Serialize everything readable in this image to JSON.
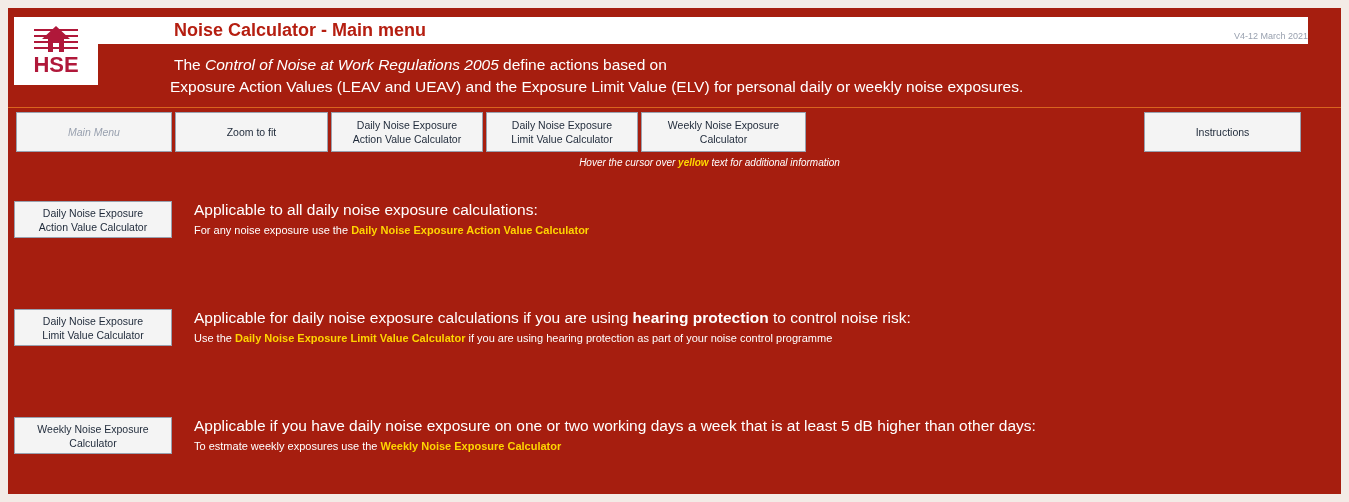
{
  "logo": {
    "text": "HSE"
  },
  "title": "Noise Calculator - Main menu",
  "version": "V4-12 March 2021",
  "intro": [
    "The  *Control of Noise at Work Regulations 2005*  define actions based on",
    "Exposure Action Values (LEAV and UEAV) and the Exposure Limit Value (ELV) for personal daily or weekly noise exposures."
  ],
  "menu": [
    {
      "label": "Main Menu",
      "selected": true
    },
    {
      "label": "Zoom to fit",
      "selected": false
    },
    {
      "label": "Daily Noise Exposure\nAction Value Calculator",
      "selected": false
    },
    {
      "label": "Daily Noise Exposure\nLimit Value Calculator",
      "selected": false
    },
    {
      "label": "Weekly Noise Exposure\nCalculator",
      "selected": false
    },
    {
      "label": "Instructions",
      "selected": false
    }
  ],
  "hint": {
    "before": "Hover the cursor over",
    "highlight": "yellow",
    "after": "text for additional information"
  },
  "sections": [
    {
      "button": "Daily Noise Exposure\nAction Value Calculator",
      "heading": "Applicable to all daily noise exposure calculations:",
      "description": [
        {
          "kind": "plain",
          "text": "For any noise exposure use the "
        },
        {
          "kind": "link",
          "text": "Daily Noise Exposure Action Value Calculator"
        }
      ]
    },
    {
      "button": "Daily Noise Exposure\nLimit Value Calculator",
      "heading": "Applicable for daily noise exposure calculations if you are using **hearing protection** to control noise risk:",
      "description": [
        {
          "kind": "plain",
          "text": "Use the "
        },
        {
          "kind": "link",
          "text": "Daily Noise Exposure Limit Value Calculator"
        },
        {
          "kind": "plain",
          "text": " if you are using hearing protection as part of your noise control programme"
        }
      ]
    },
    {
      "button": "Weekly Noise Exposure\nCalculator",
      "heading": "Applicable if you have daily noise exposure on one or two working days a week that is at least 5 dB higher than other days:",
      "description": [
        {
          "kind": "plain",
          "text": "To estmate weekly exposures use the "
        },
        {
          "kind": "link",
          "text": "Weekly Noise Exposure Calculator"
        }
      ]
    }
  ]
}
